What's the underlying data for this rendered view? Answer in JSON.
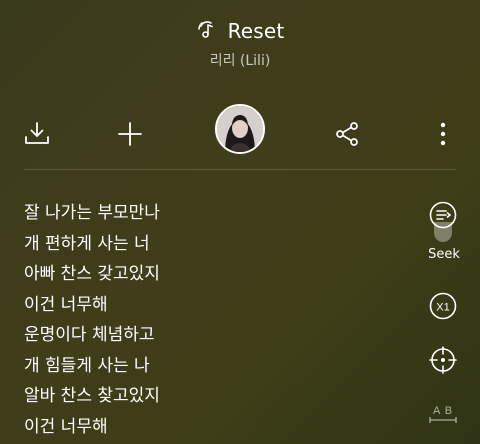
{
  "header": {
    "song_title": "Reset",
    "artist": "리리 (Lili)",
    "music_icon": "music-note-icon"
  },
  "actions": {
    "download_icon": "download-icon",
    "add_icon": "add-icon",
    "avatar": "artist-avatar",
    "share_icon": "share-icon",
    "more_icon": "more-vertical-icon"
  },
  "lyrics": [
    "잘 나가는 부모만나",
    "개 편하게 사는 너",
    "아빠 찬스 갖고있지",
    "이건 너무해",
    "운명이다 체념하고",
    "개 힘들게 사는 나",
    "알바 찬스 찾고있지",
    "이건 너무해"
  ],
  "side_tools": {
    "seek_label": "Seek",
    "speed_label": "X1",
    "translate_label": "A B"
  },
  "colors": {
    "background": "#3d3b1b",
    "text": "#ffffff"
  }
}
